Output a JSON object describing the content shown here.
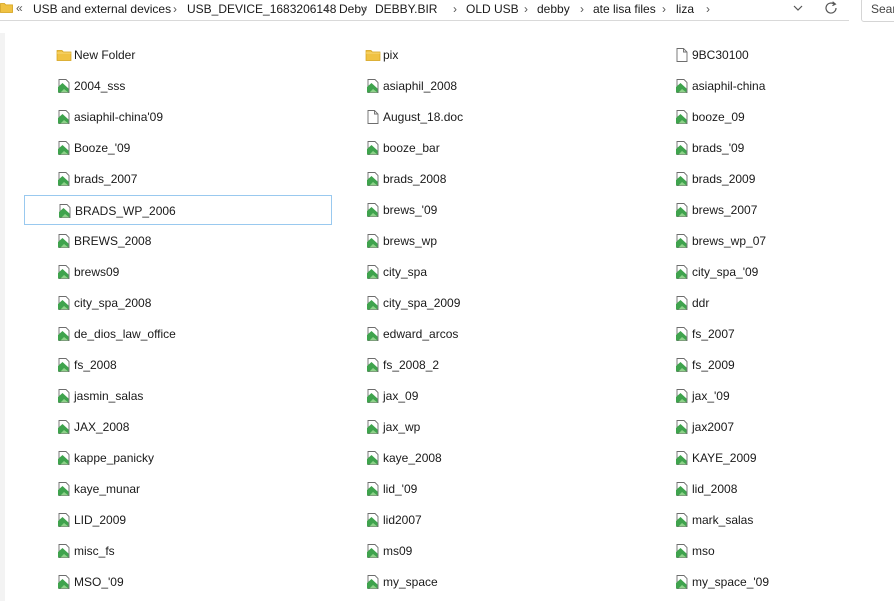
{
  "address_bar": {
    "overflow": "«",
    "crumbs": [
      "USB and external devices",
      "USB_DEVICE_1683206148",
      "Deby",
      "DEBBY.BIR",
      "OLD USB",
      "debby",
      "ate lisa files",
      "liza"
    ],
    "separator": "›",
    "dropdown_icon": "chevron-down-icon",
    "refresh_icon": "refresh-icon"
  },
  "search": {
    "placeholder": "Search"
  },
  "colors": {
    "selection_border": "#99c9ef",
    "folder": "#f0c243",
    "doc_icon": "#3fa34d"
  },
  "files": {
    "columns": [
      [
        {
          "name": "New Folder",
          "icon": "folder-icon"
        },
        {
          "name": "2004_sss",
          "icon": "file-icon"
        },
        {
          "name": "asiaphil-china'09",
          "icon": "file-icon"
        },
        {
          "name": "Booze_'09",
          "icon": "file-icon"
        },
        {
          "name": "brads_2007",
          "icon": "file-icon"
        },
        {
          "name": "BRADS_WP_2006",
          "icon": "file-icon",
          "selected": true
        },
        {
          "name": "BREWS_2008",
          "icon": "file-icon"
        },
        {
          "name": "brews09",
          "icon": "file-icon"
        },
        {
          "name": "city_spa_2008",
          "icon": "file-icon"
        },
        {
          "name": "de_dios_law_office",
          "icon": "file-icon"
        },
        {
          "name": "fs_2008",
          "icon": "file-icon"
        },
        {
          "name": "jasmin_salas",
          "icon": "file-icon"
        },
        {
          "name": "JAX_2008",
          "icon": "file-icon"
        },
        {
          "name": "kappe_panicky",
          "icon": "file-icon"
        },
        {
          "name": "kaye_munar",
          "icon": "file-icon"
        },
        {
          "name": "LID_2009",
          "icon": "file-icon"
        },
        {
          "name": "misc_fs",
          "icon": "file-icon"
        },
        {
          "name": "MSO_'09",
          "icon": "file-icon"
        }
      ],
      [
        {
          "name": "pix",
          "icon": "folder-icon"
        },
        {
          "name": "asiaphil_2008",
          "icon": "file-icon"
        },
        {
          "name": "August_18.doc",
          "icon": "blank-file-icon"
        },
        {
          "name": "booze_bar",
          "icon": "file-icon"
        },
        {
          "name": "brads_2008",
          "icon": "file-icon"
        },
        {
          "name": "brews_'09",
          "icon": "file-icon"
        },
        {
          "name": "brews_wp",
          "icon": "file-icon"
        },
        {
          "name": "city_spa",
          "icon": "file-icon"
        },
        {
          "name": "city_spa_2009",
          "icon": "file-icon"
        },
        {
          "name": "edward_arcos",
          "icon": "file-icon"
        },
        {
          "name": "fs_2008_2",
          "icon": "file-icon"
        },
        {
          "name": "jax_09",
          "icon": "file-icon"
        },
        {
          "name": "jax_wp",
          "icon": "file-icon"
        },
        {
          "name": "kaye_2008",
          "icon": "file-icon"
        },
        {
          "name": "lid_'09",
          "icon": "file-icon"
        },
        {
          "name": "lid2007",
          "icon": "file-icon"
        },
        {
          "name": "ms09",
          "icon": "file-icon"
        },
        {
          "name": "my_space",
          "icon": "file-icon"
        }
      ],
      [
        {
          "name": "9BC30100",
          "icon": "blank-file-icon"
        },
        {
          "name": "asiaphil-china",
          "icon": "file-icon"
        },
        {
          "name": "booze_09",
          "icon": "file-icon"
        },
        {
          "name": "brads_'09",
          "icon": "file-icon"
        },
        {
          "name": "brads_2009",
          "icon": "file-icon"
        },
        {
          "name": "brews_2007",
          "icon": "file-icon"
        },
        {
          "name": "brews_wp_07",
          "icon": "file-icon"
        },
        {
          "name": "city_spa_'09",
          "icon": "file-icon"
        },
        {
          "name": "ddr",
          "icon": "file-icon"
        },
        {
          "name": "fs_2007",
          "icon": "file-icon"
        },
        {
          "name": "fs_2009",
          "icon": "file-icon"
        },
        {
          "name": "jax_'09",
          "icon": "file-icon"
        },
        {
          "name": "jax2007",
          "icon": "file-icon"
        },
        {
          "name": "KAYE_2009",
          "icon": "file-icon"
        },
        {
          "name": "lid_2008",
          "icon": "file-icon"
        },
        {
          "name": "mark_salas",
          "icon": "file-icon"
        },
        {
          "name": "mso",
          "icon": "file-icon"
        },
        {
          "name": "my_space_'09",
          "icon": "file-icon"
        }
      ]
    ]
  }
}
